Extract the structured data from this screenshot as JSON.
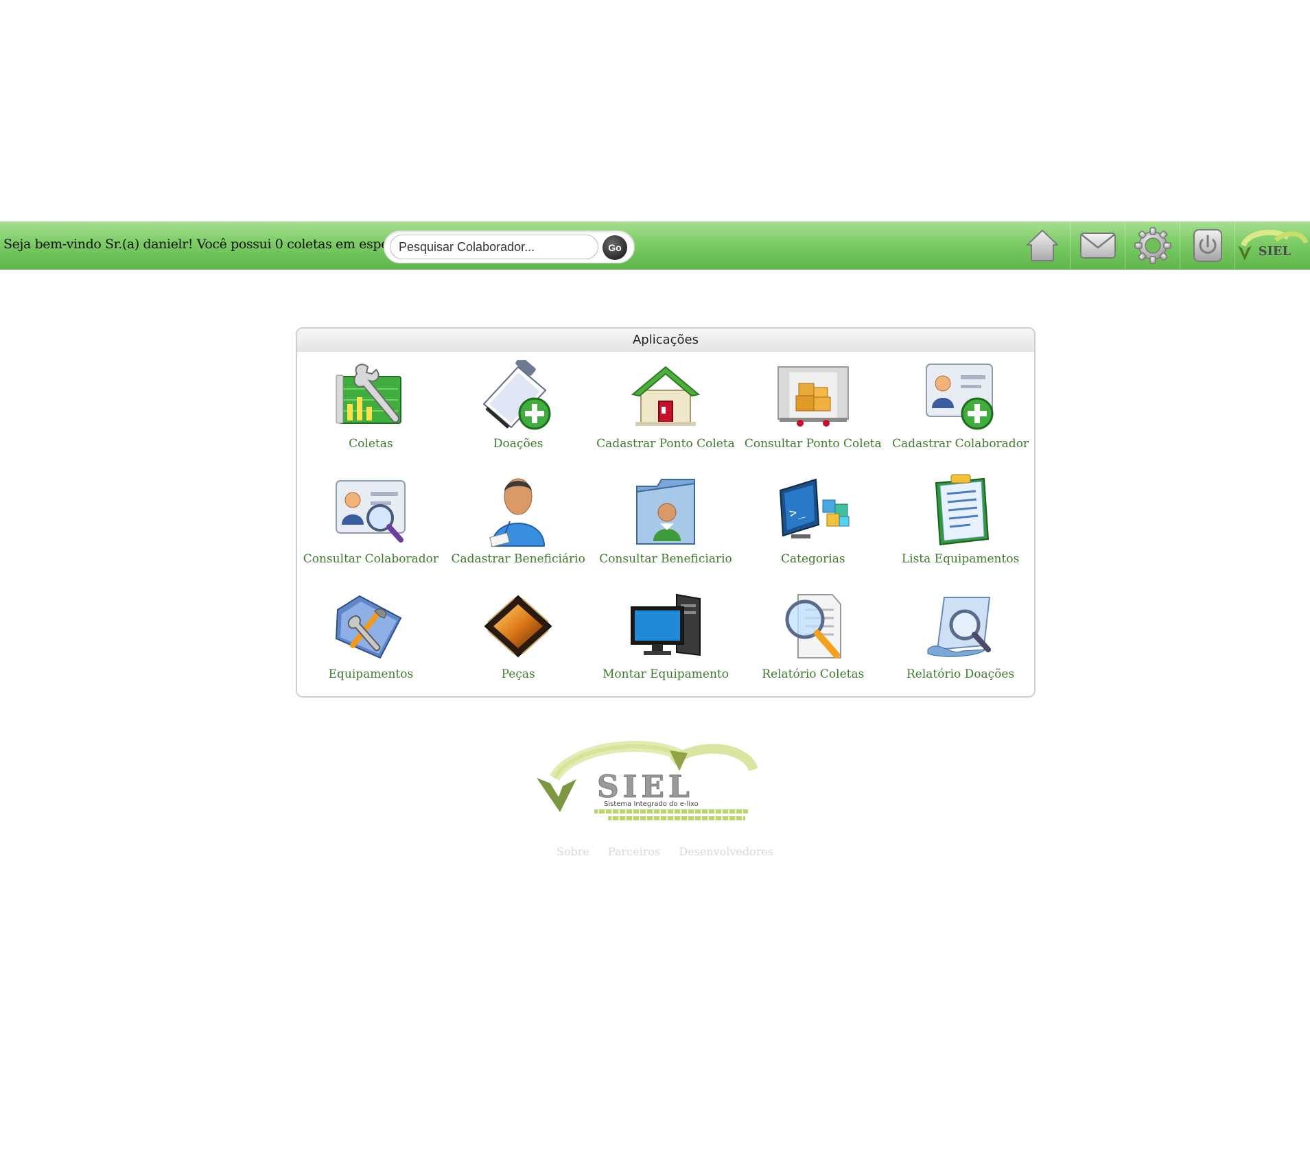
{
  "topbar": {
    "welcome_text": "Seja bem-vindo Sr.(a) danielr! Você possui 0 coletas em espera!",
    "search": {
      "placeholder": "Pesquisar Colaborador...",
      "value": "",
      "go_label": "Go"
    },
    "icons": [
      "home-icon",
      "mail-icon",
      "settings-icon",
      "power-icon"
    ],
    "logo_text": "SIEL"
  },
  "apps": {
    "title": "Aplicações",
    "items": [
      {
        "label": "Coletas",
        "icon": "wrench-chart-icon"
      },
      {
        "label": "Doações",
        "icon": "clipboard-add-icon"
      },
      {
        "label": "Cadastrar Ponto Coleta",
        "icon": "house-icon"
      },
      {
        "label": "Consultar Ponto Coleta",
        "icon": "truck-boxes-icon"
      },
      {
        "label": "Cadastrar Colaborador",
        "icon": "contact-card-add-icon"
      },
      {
        "label": "Consultar Colaborador",
        "icon": "contact-card-search-icon"
      },
      {
        "label": "Cadastrar Beneficiário",
        "icon": "person-badge-icon"
      },
      {
        "label": "Consultar Beneficiario",
        "icon": "person-folder-icon"
      },
      {
        "label": "Categorias",
        "icon": "monitor-cubes-icon"
      },
      {
        "label": "Lista Equipamentos",
        "icon": "checklist-icon"
      },
      {
        "label": "Equipamentos",
        "icon": "folder-tools-icon"
      },
      {
        "label": "Peças",
        "icon": "chip-icon"
      },
      {
        "label": "Montar Equipamento",
        "icon": "desktop-computer-icon"
      },
      {
        "label": "Relatório Coletas",
        "icon": "document-magnifier-icon"
      },
      {
        "label": "Relatório Doações",
        "icon": "page-magnifier-icon"
      }
    ]
  },
  "footer": {
    "logo_title": "SIEL",
    "logo_subtitle": "Sistema Integrado do e-lixo",
    "links": [
      "Sobre",
      "Parceiros",
      "Desenvolvedores"
    ]
  },
  "colors": {
    "topbar_green": "#7ccc66",
    "app_label_green": "#3c7a2a",
    "footer_link_gray": "#d8d8d8"
  }
}
